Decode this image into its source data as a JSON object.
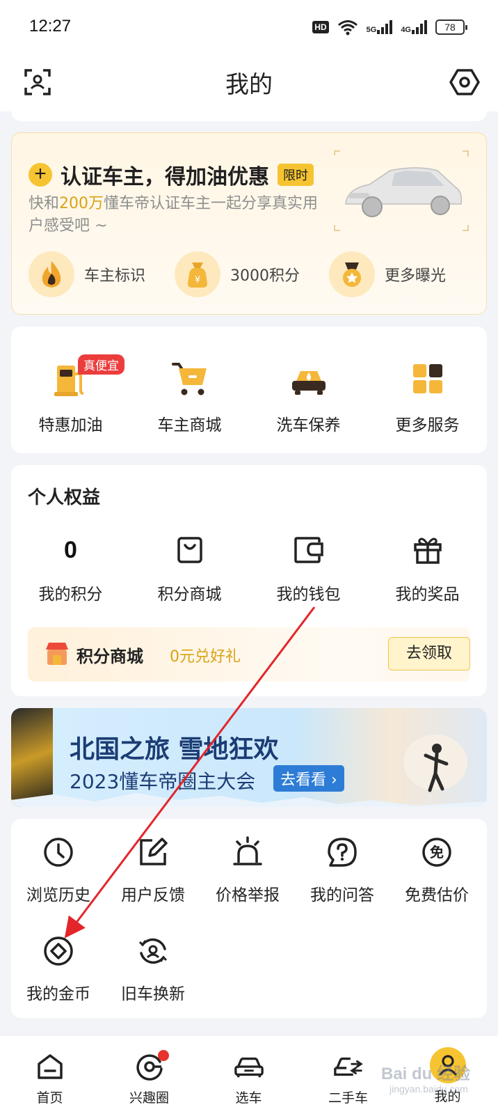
{
  "status_bar": {
    "time": "12:27",
    "hd": "HD",
    "net1": "5G",
    "net2": "4G",
    "battery": "78"
  },
  "header": {
    "title": "我的",
    "scan_icon": "scan-icon",
    "settings_icon": "hexagon-settings-icon"
  },
  "promo": {
    "title": "认证车主，得加油优惠",
    "limit_badge": "限时",
    "desc_prefix": "快和",
    "desc_highlight": "200万",
    "desc_suffix": "懂车帝认证车主一起分享真实用户感受吧 ~",
    "perks": [
      {
        "label": "车主标识",
        "icon": "flame-icon"
      },
      {
        "label": "3000积分",
        "icon": "money-bag-icon"
      },
      {
        "label": "更多曝光",
        "icon": "star-medal-icon"
      }
    ]
  },
  "services": {
    "items": [
      {
        "label": "特惠加油",
        "badge": "真便宜",
        "icon": "fuel-pump-icon"
      },
      {
        "label": "车主商城",
        "icon": "shopping-cart-icon"
      },
      {
        "label": "洗车保养",
        "icon": "car-wash-icon"
      },
      {
        "label": "更多服务",
        "icon": "grid-icon"
      }
    ]
  },
  "rights": {
    "title": "个人权益",
    "points_value": "0",
    "items": [
      {
        "label": "我的积分"
      },
      {
        "label": "积分商城",
        "icon": "shopping-bag-icon"
      },
      {
        "label": "我的钱包",
        "icon": "wallet-icon"
      },
      {
        "label": "我的奖品",
        "icon": "gift-icon"
      }
    ],
    "mall_banner": {
      "title": "积分商城",
      "subtitle": "0元兑好礼",
      "button": "去领取"
    }
  },
  "event_banner": {
    "title": "北国之旅 雪地狂欢",
    "subtitle": "2023懂车帝圈主大会",
    "button": "去看看 ›"
  },
  "tools": {
    "row1": [
      {
        "label": "浏览历史",
        "icon": "clock-icon"
      },
      {
        "label": "用户反馈",
        "icon": "edit-icon"
      },
      {
        "label": "价格举报",
        "icon": "alarm-icon"
      },
      {
        "label": "我的问答",
        "icon": "question-icon"
      },
      {
        "label": "免费估价",
        "icon": "free-icon",
        "icon_text": "免"
      }
    ],
    "row2": [
      {
        "label": "我的金币",
        "icon": "coin-icon"
      },
      {
        "label": "旧车换新",
        "icon": "trade-in-icon"
      }
    ]
  },
  "bottom_nav": [
    {
      "label": "首页",
      "icon": "home-icon"
    },
    {
      "label": "兴趣圈",
      "icon": "circle-icon"
    },
    {
      "label": "选车",
      "icon": "car-icon"
    },
    {
      "label": "二手车",
      "icon": "used-car-icon"
    },
    {
      "label": "我的",
      "icon": "profile-icon"
    }
  ],
  "watermark": {
    "text": "Bai du 经验",
    "sub": "jingyan.baidu.com"
  },
  "colors": {
    "accent": "#f6c431",
    "highlight": "#d8a316",
    "badge_red": "#ec3d3d",
    "arrow_red": "#e2262a"
  }
}
